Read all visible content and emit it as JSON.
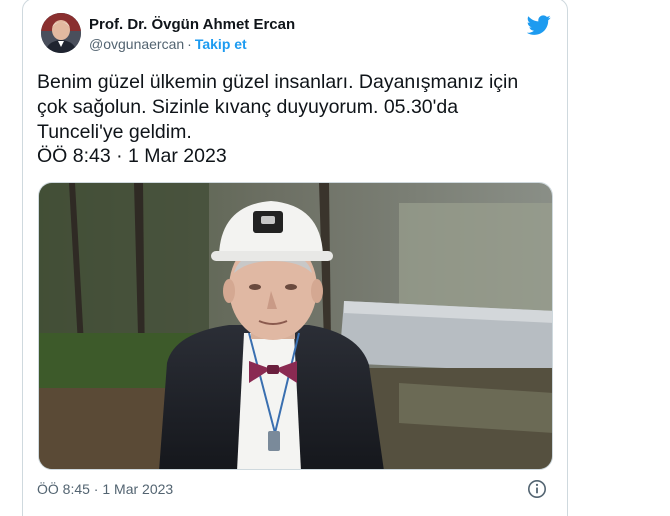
{
  "author": {
    "display_name": "Prof. Dr. Övgün Ahmet Ercan",
    "handle": "@ovgunaercan",
    "separator": "·",
    "follow_label": "Takip et"
  },
  "tweet": {
    "text": "Benim güzel ülkemin güzel insanları. Dayanışmanız için\nçok sağolun. Sizinle kıvanç duyuyorum. 05.30'da\nTunceli'ye geldim.",
    "posted_time": "ÖÖ 8:43 · 1 Mar 2023"
  },
  "footer": {
    "timestamp": "ÖÖ 8:45 · 1 Mar 2023"
  },
  "icons": {
    "brand": "twitter-bird-icon",
    "info": "info-icon"
  },
  "colors": {
    "accent": "#1d9bf0",
    "text": "#0f1419",
    "muted": "#536471",
    "border": "#cfd9de"
  }
}
